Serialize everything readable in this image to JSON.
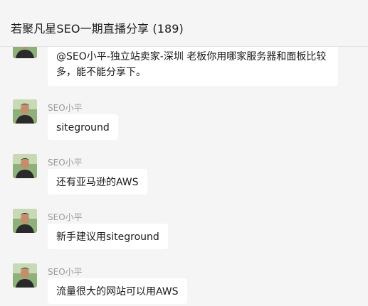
{
  "header": {
    "title": "若聚凡星SEO一期直播分享 (189)"
  },
  "messages": [
    {
      "sender": "",
      "text": "@SEO小平-独立站卖家-深圳  老板你用哪家服务器和面板比较多，能不能分享下。"
    },
    {
      "sender": "SEO小平",
      "text": "siteground"
    },
    {
      "sender": "SEO小平",
      "text": "还有亚马逊的AWS"
    },
    {
      "sender": "SEO小平",
      "text": "新手建议用siteground"
    },
    {
      "sender": "SEO小平",
      "text": "流量很大的网站可以用AWS"
    }
  ],
  "colors": {
    "background": "#f5f5f5",
    "bubble": "#ffffff",
    "sender": "#9a9a9a"
  },
  "icons": {
    "avatar": "user-avatar-icon"
  }
}
